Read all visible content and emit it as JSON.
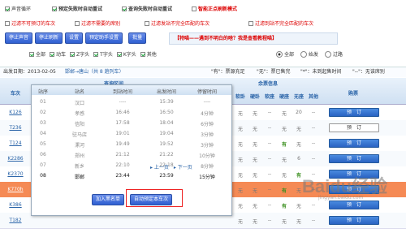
{
  "options": {
    "row1": [
      {
        "label": "声音循环",
        "checked": true,
        "red": false
      },
      {
        "label": "预定失败时自动重试",
        "checked": true,
        "red": false
      },
      {
        "label": "查询失败时自动重试",
        "checked": true,
        "red": false
      },
      {
        "label": "智能正点刷新模式",
        "checked": false,
        "red": true
      }
    ],
    "row2": [
      {
        "label": "过滤不可预订的车次",
        "checked": false
      },
      {
        "label": "过滤不需要的席别",
        "checked": false
      },
      {
        "label": "过滤发站不完全匹配的车次",
        "checked": false
      },
      {
        "label": "过滤到站不完全匹配的车次",
        "checked": false
      }
    ]
  },
  "toolbar": {
    "stop_sound": "停止声音",
    "stop_refresh": "停止刷新",
    "settings": "设置",
    "assistant_settings": "预定助手设置",
    "batch": "批量",
    "banner": "【特喵——遇到不明白的啥？我是查看教程喵】"
  },
  "train_types": {
    "items": [
      {
        "label": "全部",
        "checked": true
      },
      {
        "label": "动车",
        "checked": true
      },
      {
        "label": "Z字头",
        "checked": true
      },
      {
        "label": "T字头",
        "checked": true
      },
      {
        "label": "K字头",
        "checked": true
      },
      {
        "label": "其他",
        "checked": true
      }
    ],
    "radios": [
      "全部",
      "始发",
      "过路"
    ]
  },
  "info_bar": {
    "date": "出发日期：2013-02-05",
    "route": "邯郸→唐山（共 8 趟列车）",
    "legend1": "\"有\"：票源充足",
    "legend2": "\"无\"：票已售完",
    "legend3": "\"*\"：未到起售时间",
    "legend4": "\"--\"：无该席别"
  },
  "table": {
    "col_train": "车次",
    "group_section": "查询区间",
    "group_remaining": "余票信息",
    "col_book": "购票",
    "seat_cols": [
      "软卧",
      "硬卧",
      "软座",
      "硬座",
      "无座",
      "其他"
    ],
    "rows": [
      {
        "train": "K126",
        "seats": [
          "无",
          "无",
          "--",
          "无",
          "20",
          "--"
        ],
        "book": "预　订"
      },
      {
        "train": "T236",
        "seats": [
          "无",
          "无",
          "--",
          "无",
          "无",
          "--"
        ],
        "book": "预　订"
      },
      {
        "train": "T124",
        "seats": [
          "无",
          "无",
          "--",
          "有",
          "无",
          "--"
        ],
        "book": "预　订"
      },
      {
        "train": "K2286",
        "seats": [
          "无",
          "无",
          "--",
          "无",
          "6",
          "--"
        ],
        "book": "预　订"
      },
      {
        "train": "K2370",
        "seats": [
          "无",
          "无",
          "--",
          "无",
          "有",
          "--"
        ],
        "book": "预　订"
      },
      {
        "train": "K770h",
        "seats": [
          "无",
          "无",
          "--",
          "有",
          "无",
          "--"
        ],
        "book": "预　订"
      },
      {
        "train": "K386",
        "seats": [
          "无",
          "无",
          "--",
          "有",
          "无",
          "--"
        ],
        "book": "预　订"
      },
      {
        "train": "T182",
        "seats": [
          "无",
          "无",
          "--",
          "无",
          "无",
          "--"
        ],
        "book": "预　订"
      }
    ]
  },
  "popup": {
    "headers": [
      "站序",
      "站名",
      "到站时间",
      "出发时间",
      "停留时间"
    ],
    "stops": [
      {
        "no": "01",
        "name": "汉口",
        "arr": "----",
        "dep": "15:39",
        "stay": "----"
      },
      {
        "no": "02",
        "name": "孝感",
        "arr": "16:46",
        "dep": "16:50",
        "stay": "4分钟"
      },
      {
        "no": "03",
        "name": "信阳",
        "arr": "17:58",
        "dep": "18:04",
        "stay": "6分钟"
      },
      {
        "no": "04",
        "name": "驻马店",
        "arr": "19:01",
        "dep": "19:04",
        "stay": "3分钟"
      },
      {
        "no": "05",
        "name": "漯河",
        "arr": "19:49",
        "dep": "19:52",
        "stay": "3分钟"
      },
      {
        "no": "06",
        "name": "郑州",
        "arr": "21:12",
        "dep": "21:22",
        "stay": "10分钟"
      },
      {
        "no": "07",
        "name": "新乡",
        "arr": "22:10",
        "dep": "22:18",
        "stay": "8分钟"
      },
      {
        "no": "08",
        "name": "邯郸",
        "arr": "23:44",
        "dep": "23:59",
        "stay": "15分钟"
      }
    ],
    "prev": "上一页",
    "next": "下一页",
    "add_blacklist": "加入黑名单",
    "auto_book": "自动预定本车次"
  },
  "watermark": "Baidu经验",
  "watermark_sub": "jingyan.baidu.com"
}
